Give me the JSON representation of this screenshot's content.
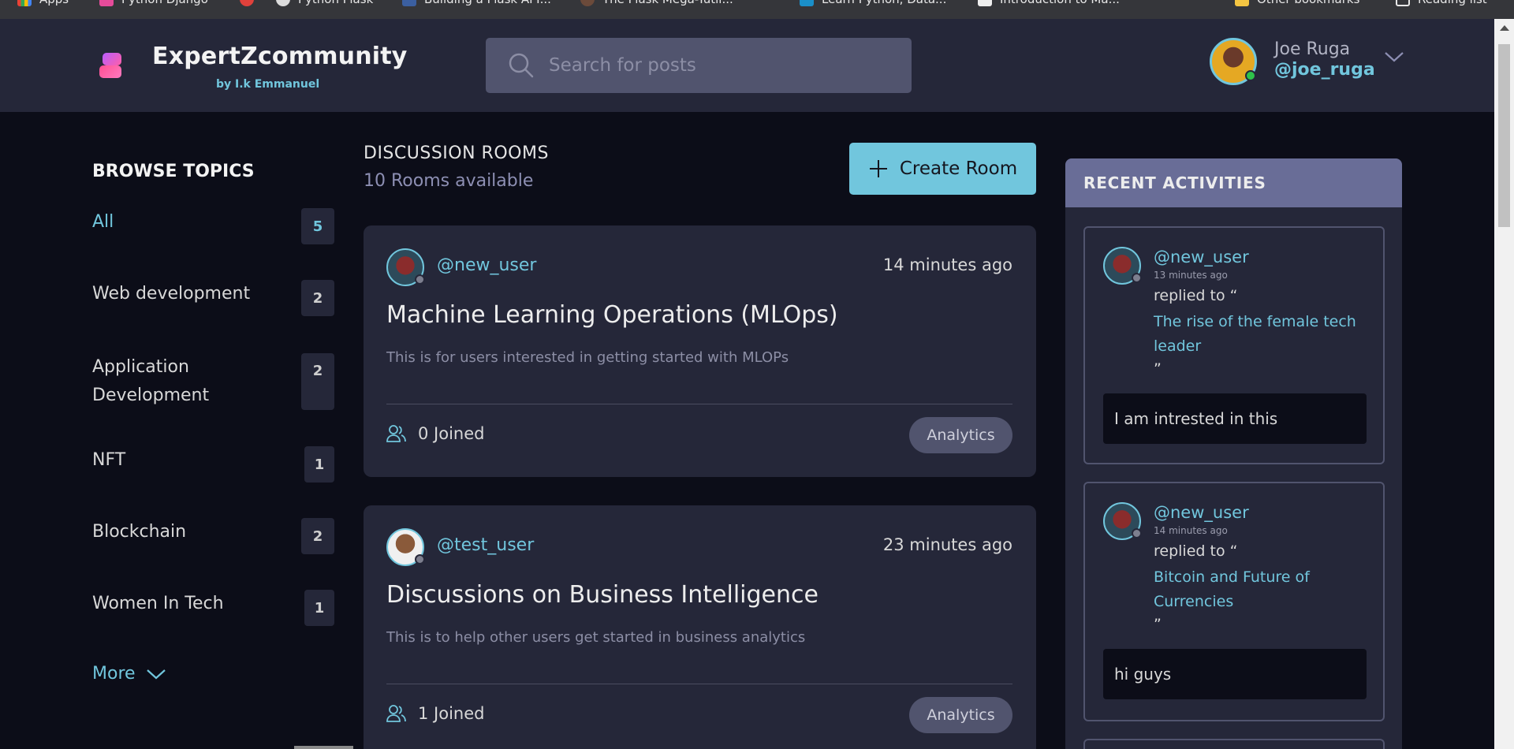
{
  "bookmarks": [
    "Apps",
    "Python Django",
    "Python Flask",
    "Building a Flask API...",
    "The Flask Mega-Tutil...",
    "Learn Python, Data...",
    "Introduction to Ma...",
    "Other bookmarks",
    "Reading list"
  ],
  "header": {
    "brand": "ExpertZcommunity",
    "byline": "by I.k Emmanuel",
    "search_placeholder": "Search for posts",
    "user_name": "Joe Ruga",
    "user_handle": "@joe_ruga"
  },
  "sidebar": {
    "title": "BROWSE TOPICS",
    "topics": [
      {
        "name": "All",
        "count": "5"
      },
      {
        "name": "Web development",
        "count": "2"
      },
      {
        "name": "Application Development",
        "count": "2"
      },
      {
        "name": "NFT",
        "count": "1"
      },
      {
        "name": "Blockchain",
        "count": "2"
      },
      {
        "name": "Women In Tech",
        "count": "1"
      }
    ],
    "more_label": "More"
  },
  "main": {
    "title": "DISCUSSION ROOMS",
    "rooms_available": "10 Rooms available",
    "create_label": "Create Room",
    "rooms": [
      {
        "host": "@new_user",
        "time": "14 minutes ago",
        "title": "Machine Learning Operations (MLOps)",
        "description": "This is for users interested in getting started with MLOPs",
        "joined": "0 Joined",
        "topic": "Analytics"
      },
      {
        "host": "@test_user",
        "time": "23 minutes ago",
        "title": "Discussions on Business Intelligence",
        "description": "This is to help other users get started in business analytics",
        "joined": "1 Joined",
        "topic": "Analytics"
      }
    ]
  },
  "activity": {
    "title": "RECENT ACTIVITIES",
    "items": [
      {
        "user": "@new_user",
        "time": "13 minutes ago",
        "replied": "replied to “",
        "topic": "The rise of the female tech leader",
        "close": "”",
        "message": "I am intrested in this"
      },
      {
        "user": "@new_user",
        "time": "14 minutes ago",
        "replied": "replied to “",
        "topic": "Bitcoin and Future of Currencies",
        "close": "”",
        "message": "hi guys"
      }
    ]
  },
  "colors": {
    "accent": "#71c6dd",
    "background": "#0c0d18",
    "panel": "#252739",
    "activity_header": "#696d97"
  }
}
